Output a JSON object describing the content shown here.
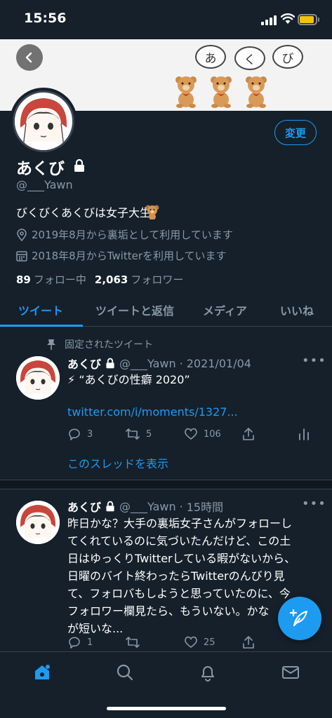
{
  "status_bar": {
    "time": "15:56"
  },
  "profile": {
    "display_name": "あくび",
    "handle": "@___Yawn",
    "bio": "びくびくあくびは女子大生",
    "location": "2019年8月から裏垢として利用しています",
    "joined": "2018年8月からTwitterを利用しています",
    "following_count": "89",
    "following_label": "フォロー中",
    "followers_count": "2,063",
    "followers_label": "フォロワー",
    "edit_label": "変更"
  },
  "banner": {
    "bubbles": [
      "あ",
      "く",
      "び"
    ]
  },
  "tabs": [
    {
      "label": "ツイート",
      "active": true
    },
    {
      "label": "ツイートと返信",
      "active": false
    },
    {
      "label": "メディア",
      "active": false
    },
    {
      "label": "いいね",
      "active": false
    }
  ],
  "tweets": [
    {
      "pinned_label": "固定されたツイート",
      "name": "あくび",
      "handle": "@___Yawn",
      "sep": "·",
      "date": "2021/01/04",
      "text": "⚡ “あくびの性癖 2020”",
      "link": "twitter.com/i/moments/1327...",
      "replies": "3",
      "retweets": "5",
      "likes": "106",
      "thread_link": "このスレッドを表示"
    },
    {
      "name": "あくび",
      "handle": "@___Yawn",
      "sep": "·",
      "date": "15時間",
      "text_lines": [
        "昨日かな？大手の裏垢女子さんがフォローし",
        "てくれているのに気づいたんだけど、この土",
        "日はゆっくりTwitterしている暇がないから、",
        "日曜のバイト終わったらTwitterのんびり見",
        "て、フォロバもしようと思っていたのに、今",
        "フォロワー欄見たら、もういない。かな",
        "が短いな..."
      ],
      "replies": "1",
      "retweets": "",
      "likes": "25"
    }
  ],
  "colors": {
    "background": "#15202b",
    "accent": "#1d9bf0",
    "secondary_text": "#8899a6"
  },
  "icons": [
    "back-arrow-icon",
    "lock-icon",
    "location-icon",
    "calendar-icon",
    "pin-icon",
    "reply-icon",
    "retweet-icon",
    "like-icon",
    "share-icon",
    "analytics-icon",
    "compose-icon",
    "home-icon",
    "search-icon",
    "bell-icon",
    "mail-icon"
  ]
}
